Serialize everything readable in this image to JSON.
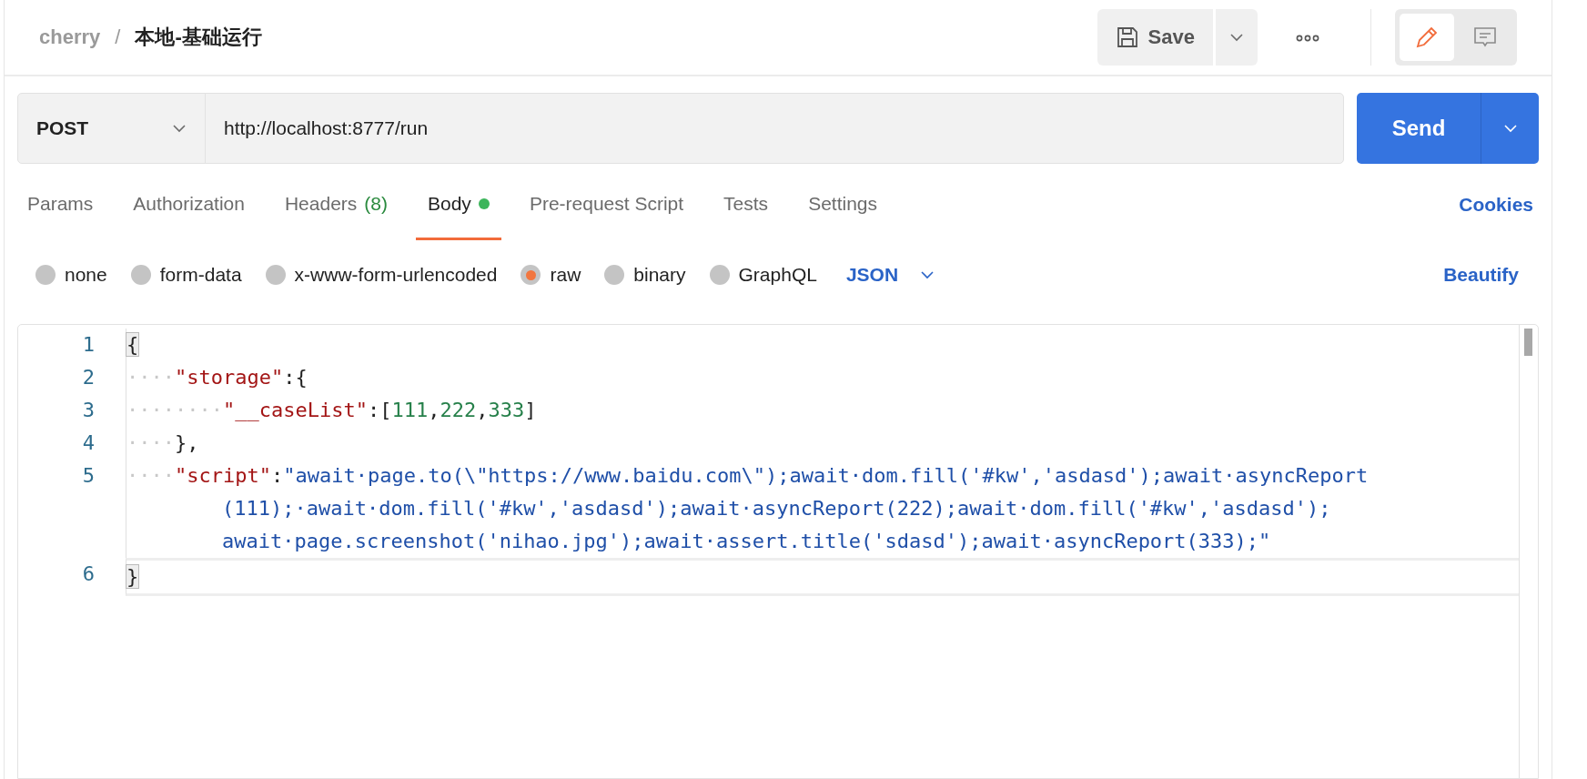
{
  "breadcrumb": {
    "workspace": "cherry",
    "separator": "/",
    "request": "本地-基础运行"
  },
  "toolbar": {
    "save": "Save"
  },
  "request": {
    "method": "POST",
    "url": "http://localhost:8777/run",
    "send": "Send"
  },
  "tabs": [
    {
      "label": "Params",
      "selected": false
    },
    {
      "label": "Authorization",
      "selected": false
    },
    {
      "label": "Headers",
      "count": "(8)",
      "selected": false
    },
    {
      "label": "Body",
      "dot": true,
      "selected": true
    },
    {
      "label": "Pre-request Script",
      "selected": false
    },
    {
      "label": "Tests",
      "selected": false
    },
    {
      "label": "Settings",
      "selected": false
    }
  ],
  "cookies": "Cookies",
  "body_types": [
    {
      "label": "none",
      "selected": false
    },
    {
      "label": "form-data",
      "selected": false
    },
    {
      "label": "x-www-form-urlencoded",
      "selected": false
    },
    {
      "label": "raw",
      "selected": true
    },
    {
      "label": "binary",
      "selected": false
    },
    {
      "label": "GraphQL",
      "selected": false
    }
  ],
  "format": "JSON",
  "beautify": "Beautify",
  "editor": {
    "lines": [
      {
        "number": "1",
        "rows": [
          [
            {
              "kind": "bracket",
              "text": "{"
            }
          ]
        ]
      },
      {
        "number": "2",
        "rows": [
          [
            {
              "kind": "ws",
              "text": "····"
            },
            {
              "kind": "key",
              "text": "\"storage\""
            },
            {
              "kind": "punct",
              "text": ":{"
            }
          ]
        ]
      },
      {
        "number": "3",
        "rows": [
          [
            {
              "kind": "ws",
              "text": "····"
            },
            {
              "kind": "ws",
              "text": "····"
            },
            {
              "kind": "key",
              "text": "\"__caseList\""
            },
            {
              "kind": "punct",
              "text": ":["
            },
            {
              "kind": "number",
              "text": "111"
            },
            {
              "kind": "punct",
              "text": ","
            },
            {
              "kind": "number",
              "text": "222"
            },
            {
              "kind": "punct",
              "text": ","
            },
            {
              "kind": "number",
              "text": "333"
            },
            {
              "kind": "punct",
              "text": "]"
            }
          ]
        ]
      },
      {
        "number": "4",
        "rows": [
          [
            {
              "kind": "ws",
              "text": "····"
            },
            {
              "kind": "punct",
              "text": "},"
            }
          ]
        ]
      },
      {
        "number": "5",
        "rows": [
          [
            {
              "kind": "ws",
              "text": "····"
            },
            {
              "kind": "key",
              "text": "\"script\""
            },
            {
              "kind": "punct",
              "text": ":"
            },
            {
              "kind": "string",
              "text": "\"await·page.to(\\\"https://www.baidu.com\\\");await·dom.fill('#kw','asdasd');await·asyncReport"
            }
          ],
          [
            {
              "kind": "string",
              "text": "(111);·await·dom.fill('#kw','asdasd');await·asyncReport(222);await·dom.fill('#kw','asdasd');"
            }
          ],
          [
            {
              "kind": "string",
              "text": "await·page.screenshot('nihao.jpg');await·assert.title('sdasd');await·asyncReport(333);\""
            }
          ]
        ]
      },
      {
        "number": "6",
        "rows": [
          [
            {
              "kind": "bracket",
              "text": "}"
            }
          ]
        ]
      }
    ]
  }
}
